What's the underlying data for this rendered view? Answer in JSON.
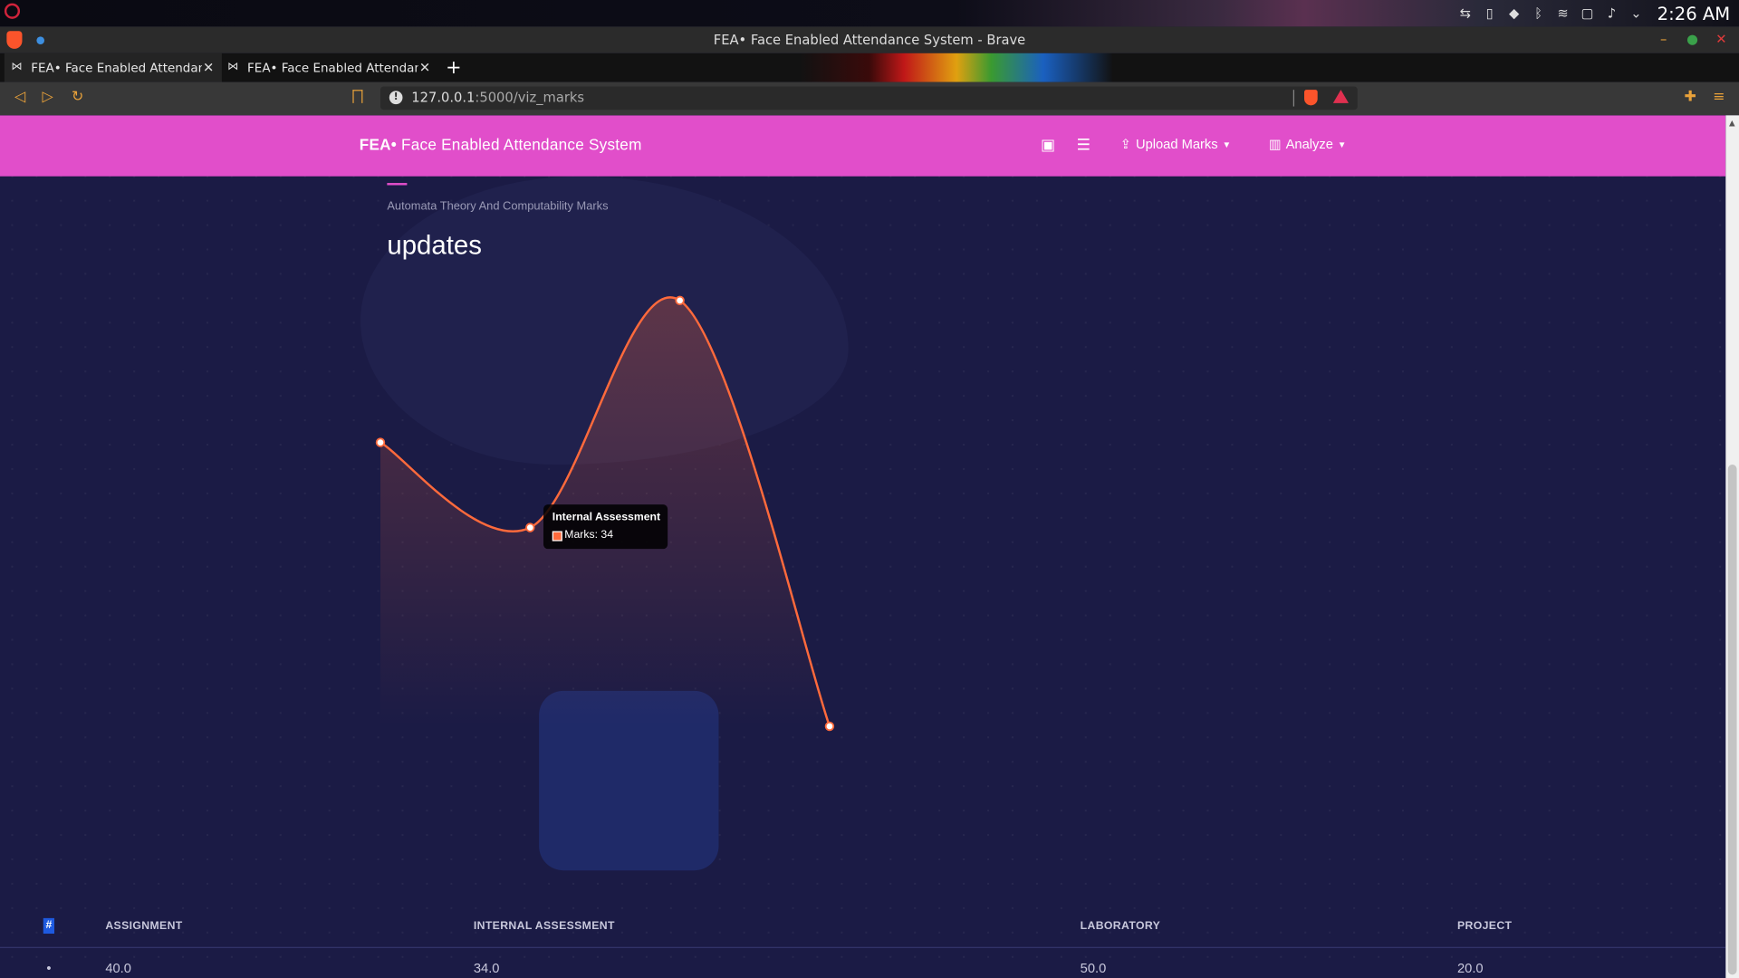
{
  "os": {
    "clock": "2:26 AM",
    "tray_icons": [
      "teamviewer-icon",
      "battery-icon",
      "dropbox-icon",
      "bluetooth-icon",
      "wifi-icon",
      "screen-icon",
      "volume-icon",
      "chevron-down-icon"
    ]
  },
  "window": {
    "title": "FEA• Face Enabled Attendance System - Brave"
  },
  "tabs": [
    {
      "label": "FEA• Face Enabled Attendance System"
    },
    {
      "label": "FEA• Face Enabled Attendance System"
    }
  ],
  "address_bar": {
    "url_host": "127.0.0.1",
    "url_rest": ":5000/viz_marks"
  },
  "navbar": {
    "brand_bold": "FEA•",
    "brand_rest": " Face Enabled Attendance System",
    "upload_label": "Upload Marks",
    "analyze_label": "Analyze"
  },
  "card": {
    "category": "Automata Theory And Computability Marks",
    "title": "updates"
  },
  "chart_data": {
    "type": "line",
    "categories": [
      "Assignment",
      "Internal Assessment",
      "Laboratory",
      "Project"
    ],
    "series": [
      {
        "name": "Marks",
        "values": [
          40,
          34,
          50,
          20
        ]
      }
    ],
    "ylim": [
      20,
      50
    ],
    "colors": {
      "line": "#ff6a3c",
      "fill_top": "#ff6a3c"
    }
  },
  "tooltip": {
    "title": "Internal Assessment",
    "body": "Marks: 34"
  },
  "table": {
    "hash_header": "#",
    "headers": [
      "ASSIGNMENT",
      "INTERNAL ASSESSMENT",
      "LABORATORY",
      "PROJECT"
    ],
    "row": {
      "bullet": "•",
      "values": [
        "40.0",
        "34.0",
        "50.0",
        "20.0"
      ]
    }
  }
}
